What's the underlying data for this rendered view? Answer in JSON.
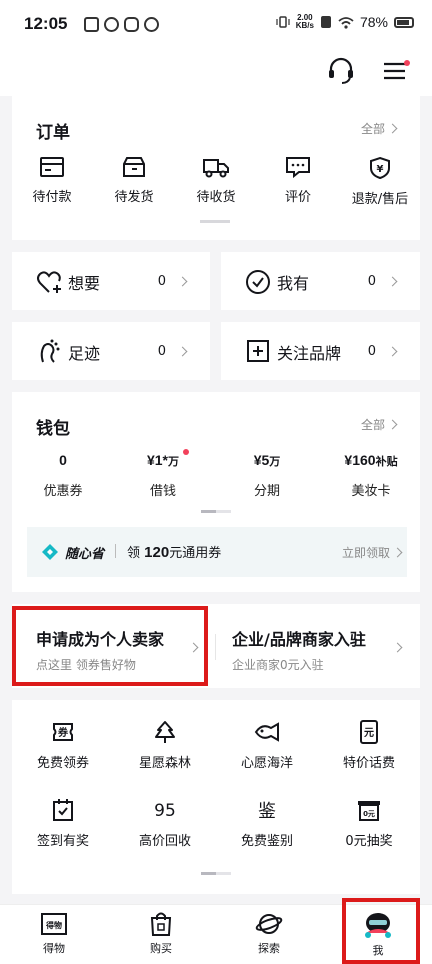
{
  "status_bar": {
    "time": "12:05",
    "net_speed_value": "2.00",
    "net_speed_unit": "KB/s",
    "battery": "78%"
  },
  "orders": {
    "title": "订单",
    "more": "全部",
    "items": [
      {
        "label": "待付款",
        "icon": "wallet-card-icon"
      },
      {
        "label": "待发货",
        "icon": "box-icon"
      },
      {
        "label": "待收货",
        "icon": "truck-icon"
      },
      {
        "label": "评价",
        "icon": "chat-icon"
      },
      {
        "label": "退款/售后",
        "icon": "refund-shield-icon"
      }
    ]
  },
  "quick": {
    "want": {
      "label": "想要",
      "count": "0"
    },
    "have": {
      "label": "我有",
      "count": "0"
    },
    "footprint": {
      "label": "足迹",
      "count": "0"
    },
    "brands": {
      "label": "关注品牌",
      "count": "0"
    }
  },
  "wallet": {
    "title": "钱包",
    "more": "全部",
    "items": [
      {
        "value": "0",
        "suffix": "",
        "label": "优惠券"
      },
      {
        "value": "¥1*",
        "suffix": "万",
        "label": "借钱"
      },
      {
        "value": "¥5",
        "suffix": "万",
        "label": "分期"
      },
      {
        "value": "¥160",
        "suffix": "补贴",
        "label": "美妆卡"
      }
    ],
    "promo": {
      "brand": "随心省",
      "text_prefix": "领",
      "amount": "120",
      "text_suffix": "元通用券",
      "action": "立即领取"
    }
  },
  "seller": {
    "personal": {
      "title": "申请成为个人卖家",
      "sub": "点这里 领券售好物"
    },
    "business": {
      "title": "企业/品牌商家入驻",
      "sub": "企业商家0元入驻"
    }
  },
  "services": [
    {
      "label": "免费领券",
      "icon": "ticket-icon"
    },
    {
      "label": "星愿森林",
      "icon": "tree-icon"
    },
    {
      "label": "心愿海洋",
      "icon": "fish-icon"
    },
    {
      "label": "特价话费",
      "icon": "phone-bill-icon"
    },
    {
      "label": "签到有奖",
      "icon": "calendar-check-icon"
    },
    {
      "label": "高价回收",
      "icon": "recycle-95-icon"
    },
    {
      "label": "免费鉴别",
      "icon": "appraise-icon"
    },
    {
      "label": "0元抽奖",
      "icon": "lottery-icon"
    }
  ],
  "service_glyphs": {
    "ticket": "券",
    "recycle": "95",
    "appraise": "鉴",
    "phone": "元",
    "lottery": "0元"
  },
  "nav": [
    {
      "label": "得物",
      "glyph": "得物"
    },
    {
      "label": "购买"
    },
    {
      "label": "探索"
    },
    {
      "label": "我"
    }
  ],
  "colors": {
    "accent_red": "#dc1a1a",
    "dot_pink": "#f2415b",
    "teal": "#16b9c6"
  }
}
